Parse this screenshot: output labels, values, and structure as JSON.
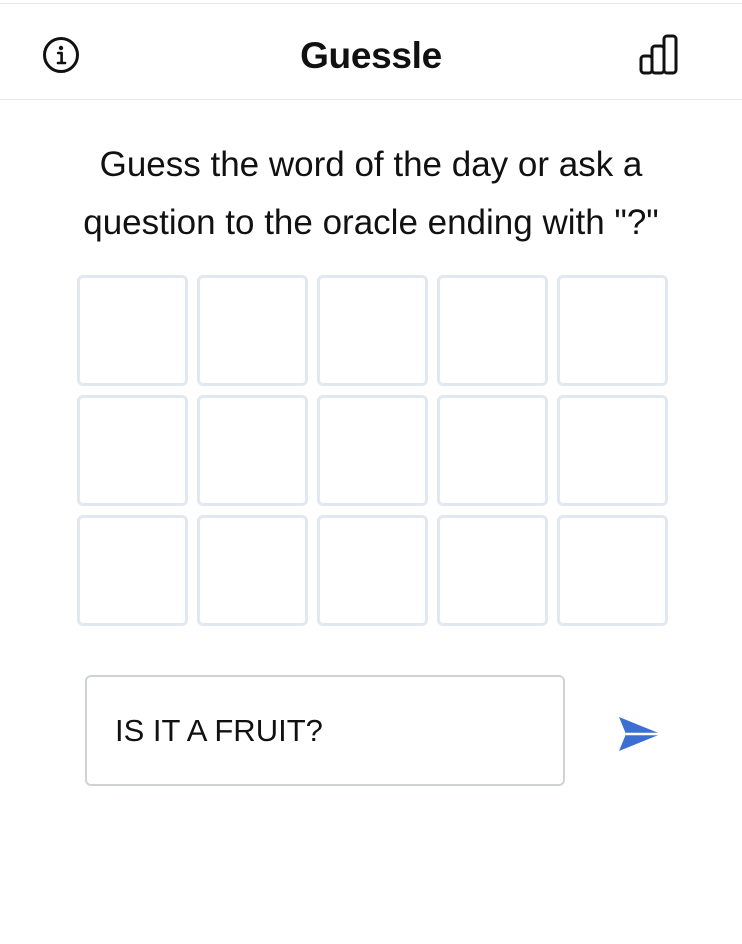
{
  "header": {
    "title": "Guessle",
    "info_icon": "info-circle-icon",
    "stats_icon": "bar-chart-icon"
  },
  "instructions": "Guess the word of the day or ask a question to the oracle ending with \"?\"",
  "grid": {
    "rows": [
      [
        "",
        "",
        "",
        "",
        ""
      ],
      [
        "",
        "",
        "",
        "",
        ""
      ],
      [
        "",
        "",
        "",
        "",
        ""
      ]
    ]
  },
  "input": {
    "value": "IS IT A FRUIT?"
  },
  "send": {
    "icon": "send-icon",
    "color": "#3b6fd1"
  },
  "colors": {
    "tile_border": "#e2e8f0",
    "input_border": "#cfd3d8",
    "accent": "#3b6fd1"
  }
}
